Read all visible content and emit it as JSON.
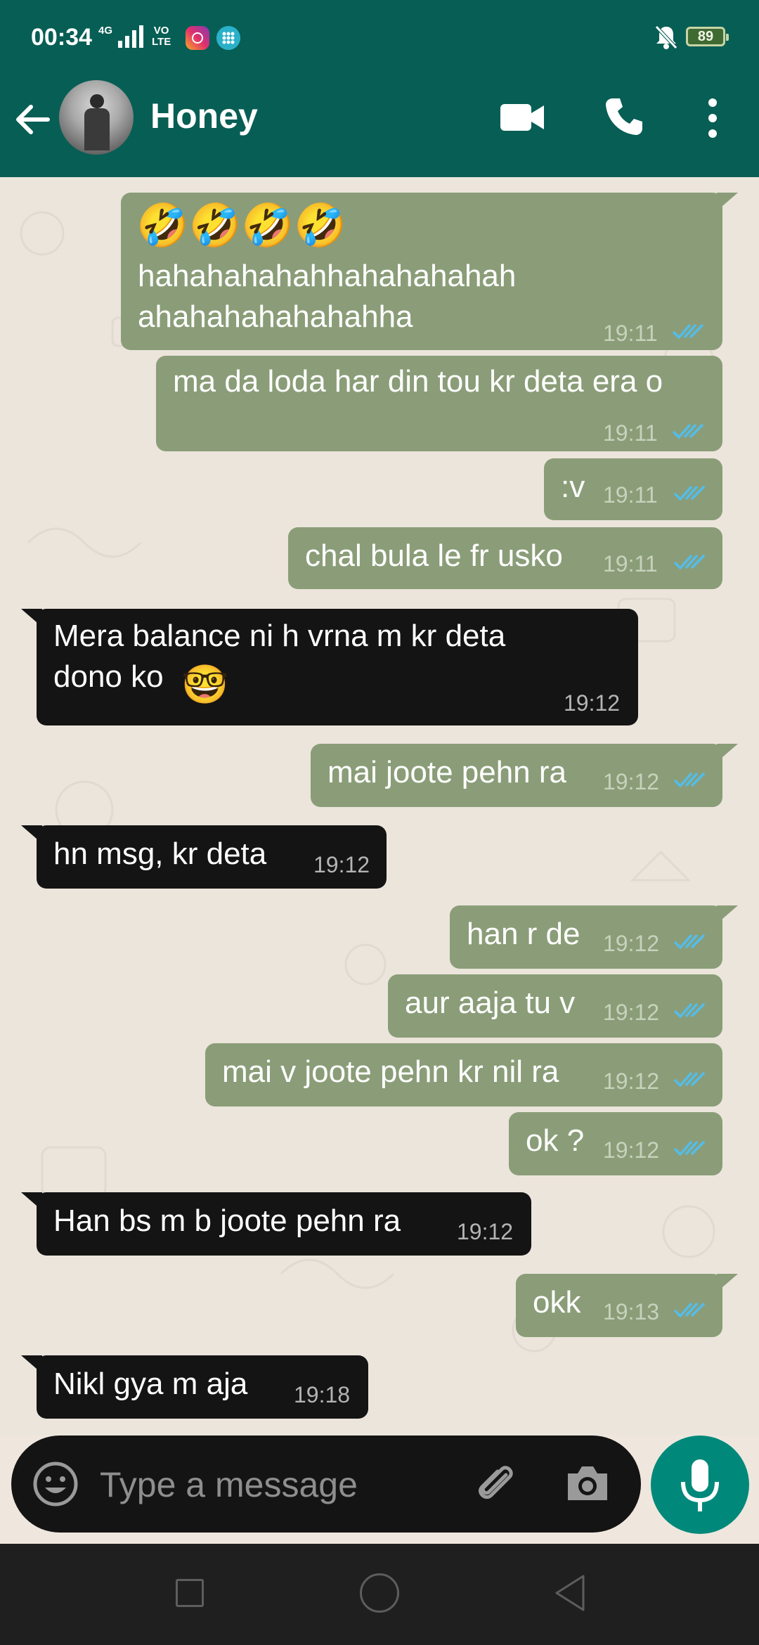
{
  "status_bar": {
    "time": "00:34",
    "network": "4G",
    "volte_top": "VO",
    "volte_bottom": "LTE",
    "battery": "89"
  },
  "header": {
    "contact_name": "Honey",
    "icons": [
      "back-arrow-icon",
      "avatar",
      "video-call-icon",
      "phone-icon",
      "more-vert-icon"
    ]
  },
  "messages": [
    {
      "dir": "out",
      "emoji": "🤣🤣🤣🤣",
      "text": "hahahahahahhahahahahah\nahahahahahahahha",
      "time": "19:11",
      "status": "read"
    },
    {
      "dir": "out",
      "text": "ma da loda har din tou kr deta era o",
      "time": "19:11",
      "status": "read"
    },
    {
      "dir": "out",
      "text": ":v",
      "time": "19:11",
      "status": "read"
    },
    {
      "dir": "out",
      "text": "chal bula le fr usko",
      "time": "19:11",
      "status": "read"
    },
    {
      "dir": "in",
      "text": "Mera balance ni h vrna m kr deta\ndono ko",
      "emoji": "🤓",
      "time": "19:12"
    },
    {
      "dir": "out",
      "text": "mai joote pehn ra",
      "time": "19:12",
      "status": "read"
    },
    {
      "dir": "in",
      "text": "hn msg, kr deta",
      "time": "19:12"
    },
    {
      "dir": "out",
      "text": "han r de",
      "time": "19:12",
      "status": "read"
    },
    {
      "dir": "out",
      "text": "aur aaja tu v",
      "time": "19:12",
      "status": "read"
    },
    {
      "dir": "out",
      "text": "mai v joote pehn kr nil ra",
      "time": "19:12",
      "status": "read"
    },
    {
      "dir": "out",
      "text": "ok ?",
      "time": "19:12",
      "status": "read"
    },
    {
      "dir": "in",
      "text": "Han bs m b joote pehn ra",
      "time": "19:12"
    },
    {
      "dir": "out",
      "text": "okk",
      "time": "19:13",
      "status": "read"
    },
    {
      "dir": "in",
      "text": "Nikl gya m aja",
      "time": "19:18"
    }
  ],
  "input": {
    "placeholder": "Type a message"
  },
  "colors": {
    "header_bg": "#075e54",
    "outgoing_bubble": "#8a9d78",
    "incoming_bubble": "#141414",
    "read_ticks": "#53bdeb",
    "mic_button": "#00897b"
  }
}
